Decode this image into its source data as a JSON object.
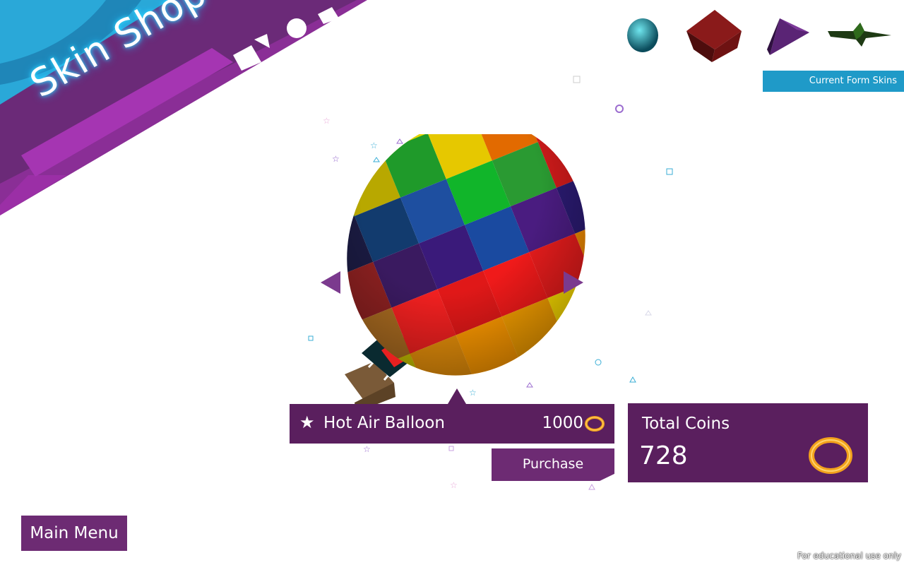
{
  "screen": {
    "title": "Skin Shop"
  },
  "forms": {
    "label": "Current Form Skins",
    "icons": [
      "sphere-icon",
      "cube-icon",
      "pyramid-icon",
      "star-icon"
    ]
  },
  "item": {
    "name": "Hot Air Balloon",
    "price": "1000",
    "icon": "star-icon"
  },
  "purchase": {
    "label": "Purchase"
  },
  "coins": {
    "label": "Total Coins",
    "value": "728"
  },
  "nav": {
    "main_menu": "Main Menu"
  },
  "footer": {
    "notice": "For educational use only"
  },
  "colors": {
    "purple_dark": "#5a1f5e",
    "purple_button": "#6d2b73",
    "magenta": "#9b2fa6",
    "blue_banner": "#1f9ac8",
    "coin_gold": "#f2a11c"
  }
}
